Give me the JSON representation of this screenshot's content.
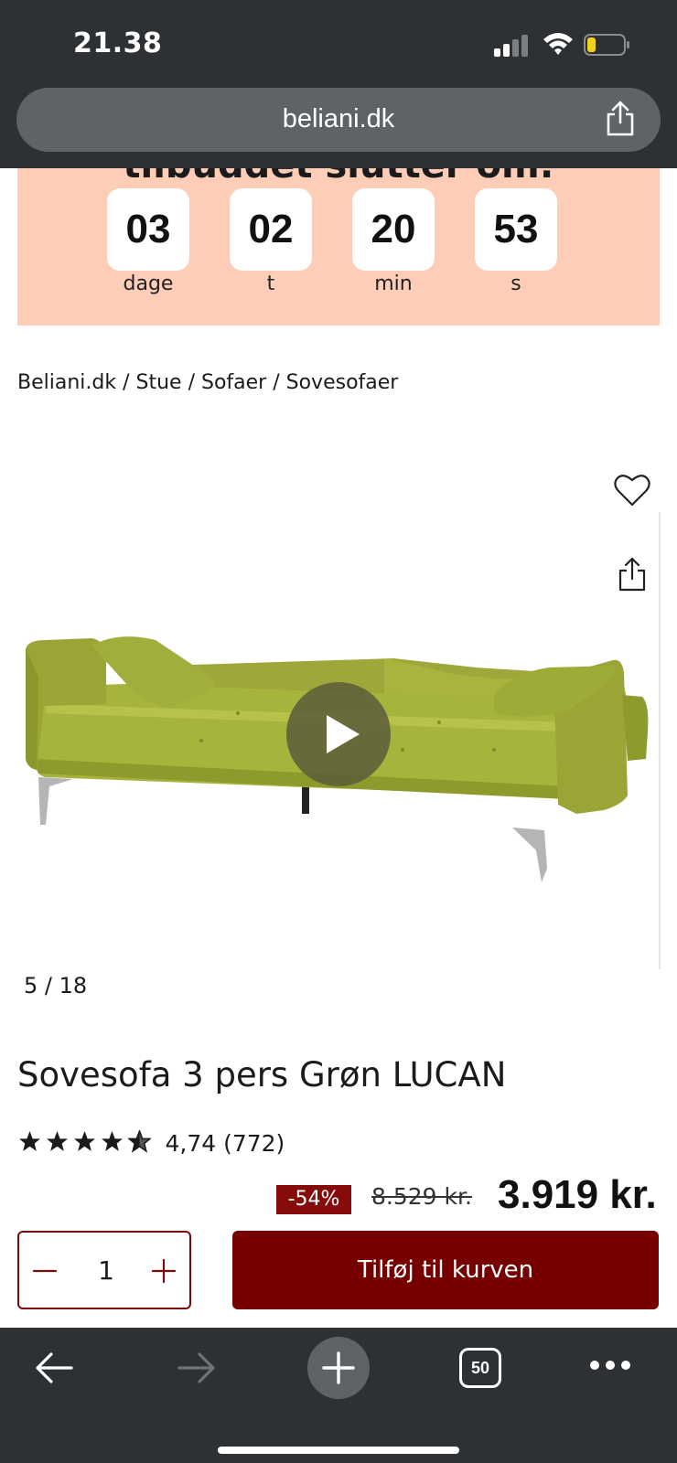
{
  "status_bar": {
    "time": "21.38"
  },
  "browser": {
    "url": "beliani.dk",
    "tab_count": "50"
  },
  "promo": {
    "heading": "tilbuddet slutter om:",
    "countdown": [
      {
        "value": "03",
        "unit": "dage"
      },
      {
        "value": "02",
        "unit": "t"
      },
      {
        "value": "20",
        "unit": "min"
      },
      {
        "value": "53",
        "unit": "s"
      }
    ]
  },
  "breadcrumb": [
    "Beliani.dk",
    "Stue",
    "Sofaer",
    "Sovesofaer"
  ],
  "breadcrumb_separator": " / ",
  "gallery": {
    "counter": "5 / 18"
  },
  "product": {
    "title": "Sovesofa 3 pers Grøn LUCAN",
    "rating_stars": 4.74,
    "rating_text": "4,74 (772)",
    "discount": "-54%",
    "old_price": "8.529 kr.",
    "new_price": "3.919 kr."
  },
  "cart": {
    "quantity": "1",
    "add_label": "Tilføj til kurven"
  },
  "colors": {
    "chrome": "#2e3134",
    "promo_bg": "#fecdb8",
    "brand_red": "#760000",
    "sofa_green": "#a7b43c"
  },
  "icons": [
    "signal-icon",
    "wifi-icon",
    "battery-icon",
    "share-icon",
    "heart-icon",
    "play-icon",
    "star-icon",
    "minus-icon",
    "plus-icon",
    "back-icon",
    "forward-icon",
    "new-tab-icon",
    "tabs-icon",
    "more-icon"
  ]
}
